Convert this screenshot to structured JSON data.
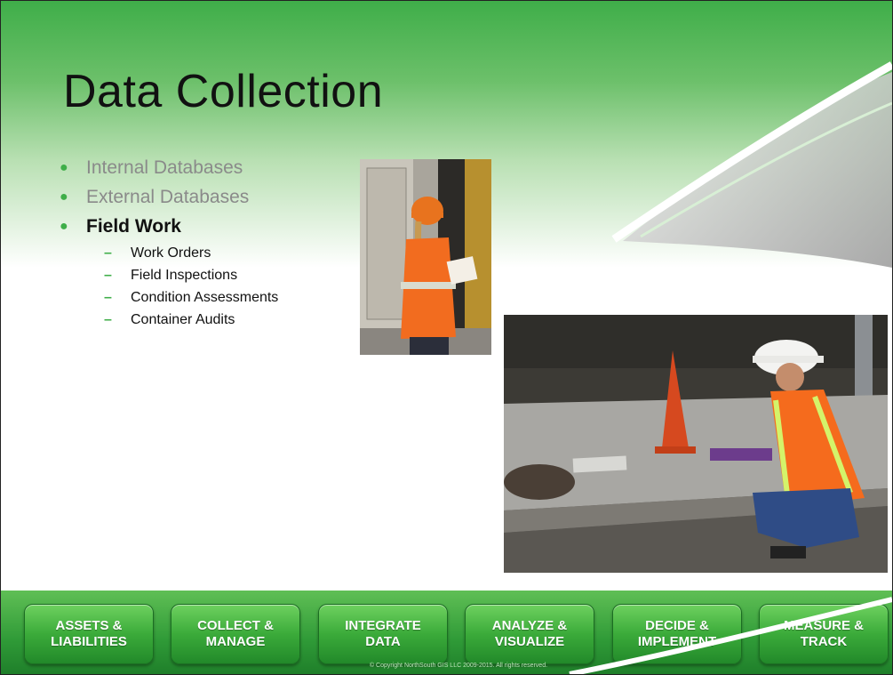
{
  "slide": {
    "title": "Data Collection"
  },
  "bullets": [
    {
      "text": "Internal Databases",
      "state": "dim"
    },
    {
      "text": "External Databases",
      "state": "dim"
    },
    {
      "text": "Field Work",
      "state": "active",
      "subitems": [
        "Work Orders",
        "Field Inspections",
        "Condition Assessments",
        "Container Audits"
      ]
    }
  ],
  "nav": {
    "buttons": [
      "ASSETS &\nLIABILITIES",
      "COLLECT &\nMANAGE",
      "INTEGRATE\nDATA",
      "ANALYZE &\nVISUALIZE",
      "DECIDE &\nIMPLEMENT",
      "MEASURE &\nTRACK"
    ]
  },
  "footer": {
    "copyright": "© Copyright NorthSouth GIS LLC 2009-2015. All rights reserved."
  },
  "colors": {
    "brand_green": "#3fae49",
    "dark_green": "#1f7f2a",
    "bullet_dim": "#8a8a8a"
  },
  "icons": {
    "bullet": "bullet-dot-icon",
    "sub_bullet": "dash-icon"
  },
  "images": {
    "photo1": "worker-with-clipboard-photo",
    "photo2": "worker-kneeling-curb-photo"
  }
}
